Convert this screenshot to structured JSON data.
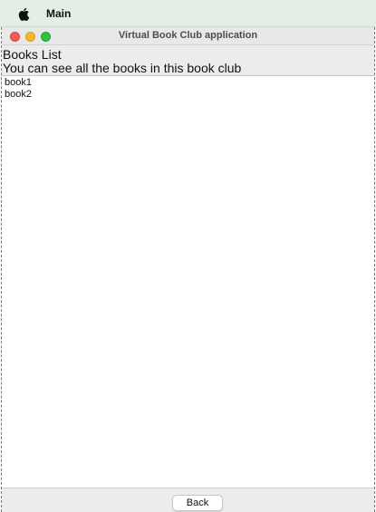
{
  "menubar": {
    "apple_icon": "apple-icon",
    "app_name": "Main"
  },
  "window": {
    "title": "Virtual Book Club application",
    "controls": {
      "close_color": "#f25a52",
      "minimize_color": "#f5b82c",
      "zoom_color": "#2dc23f"
    }
  },
  "books_panel": {
    "heading": "Books List",
    "subtitle": "You can see all the books in this book club",
    "items": [
      {
        "label": "book1"
      },
      {
        "label": "book2"
      }
    ]
  },
  "footer": {
    "back_label": "Back"
  }
}
